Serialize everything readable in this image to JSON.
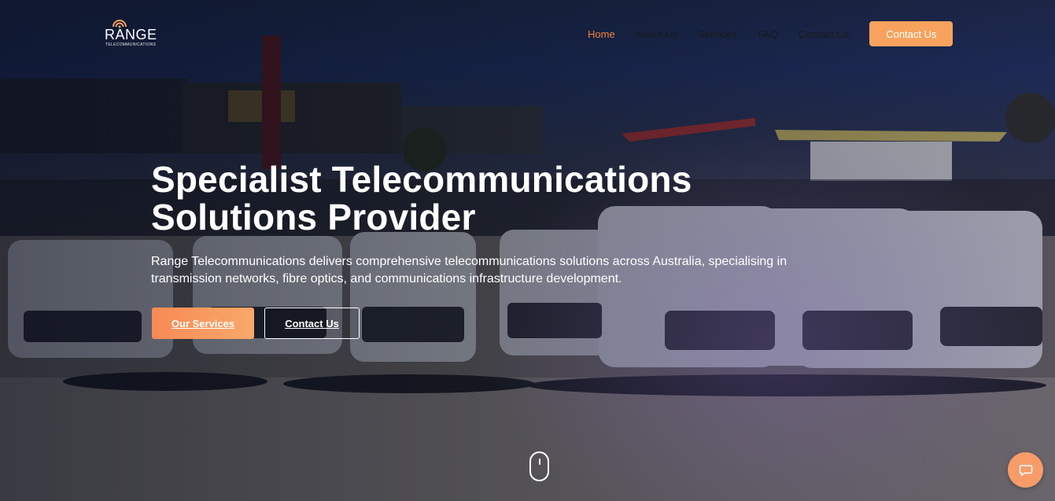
{
  "brand": {
    "name": "RANGE",
    "tagline": "TELECOMMUNICATIONS",
    "accent": "#f7a35e"
  },
  "nav": {
    "items": [
      {
        "label": "Home",
        "active": true
      },
      {
        "label": "About Us",
        "active": false
      },
      {
        "label": "Services",
        "active": false
      },
      {
        "label": "FAQ",
        "active": false
      },
      {
        "label": "Contact Us",
        "active": false
      }
    ],
    "cta_label": "Contact Us"
  },
  "hero": {
    "headline_line1": "Specialist Telecommunications",
    "headline_line2": "Solutions Provider",
    "description": "Range Telecommunications delivers comprehensive telecommunications solutions across Australia, specialising in transmission networks, fibre optics, and communications infrastructure development.",
    "primary_button": "Our Services",
    "secondary_button": "Contact Us"
  },
  "icons": {
    "scroll_indicator": "mouse-icon",
    "chat": "chat-icon",
    "logo_mark": "signal-icon"
  }
}
